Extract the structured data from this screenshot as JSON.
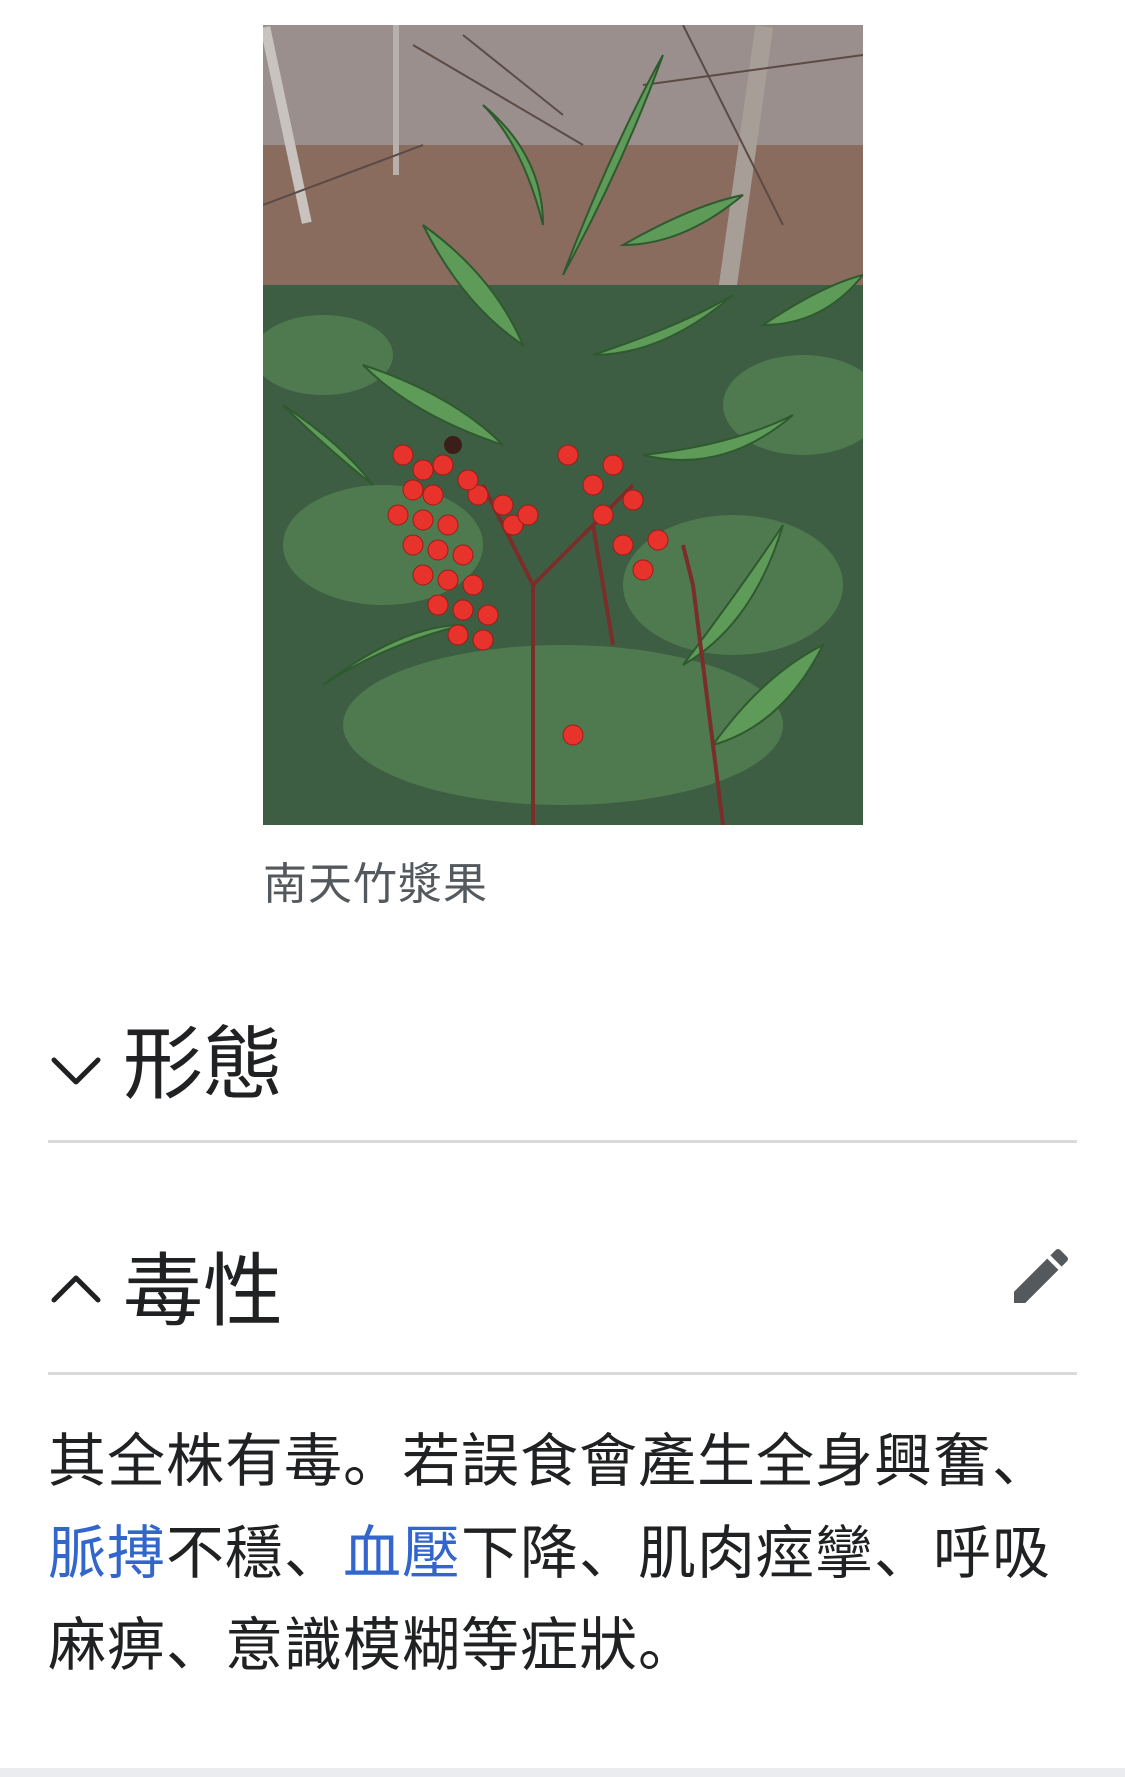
{
  "figure": {
    "caption": "南天竹漿果"
  },
  "sections": [
    {
      "title": "形態",
      "state": "collapsed",
      "chevron_icon": "chevron-down-icon"
    },
    {
      "title": "毒性",
      "state": "expanded",
      "chevron_icon": "chevron-up-icon",
      "edit_icon": "pencil-icon"
    }
  ],
  "toxicity_paragraph": {
    "part1": "其全株有毒。若誤食會產生全身興奮、",
    "link1": "脈搏",
    "part2": "不穩、",
    "link2": "血壓",
    "part3": "下降、肌肉痙攣、呼吸麻痹、意識模糊等症狀。"
  },
  "colors": {
    "link": "#3366cc",
    "text": "#202122",
    "caption": "#54595d",
    "divider": "#d9dadb"
  }
}
